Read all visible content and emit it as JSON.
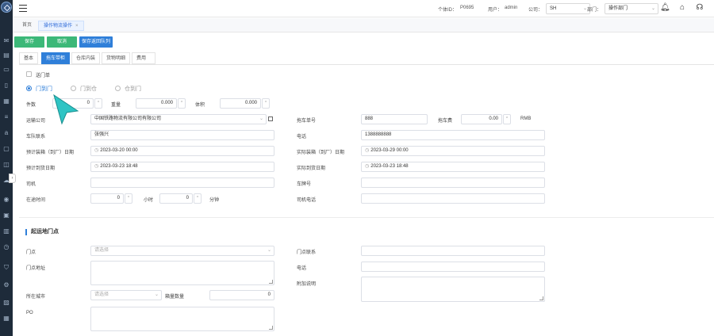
{
  "topbar": {
    "customer_id_label": "个体ID：",
    "customer_id_value": "P0695",
    "user_label": "用户：",
    "user_value": "admin",
    "company_label": "公司：",
    "company_value": "SH",
    "dept_label": "部门：",
    "dept_value": "操作部门"
  },
  "tabs": [
    {
      "label": "首页"
    },
    {
      "label": "操作物流操作",
      "close": "×"
    }
  ],
  "buttons": {
    "save": "保存",
    "cancel": "取消",
    "save_return": "保存返回队列"
  },
  "form_tabs": [
    {
      "label": "基本"
    },
    {
      "label": "拖车带柜"
    },
    {
      "label": "仓库内装"
    },
    {
      "label": "货物明细"
    },
    {
      "label": "费用"
    }
  ],
  "main": {
    "door_pickup_label": "送门单",
    "radios": [
      "门到门",
      "门到仓",
      "仓到门"
    ],
    "pieces_label": "件数",
    "pieces_value": "0",
    "weight_label": "重量",
    "weight_value": "0.000",
    "volume_label": "体积",
    "volume_value": "0.000",
    "transport_company_label": "运输公司",
    "transport_company_value": "中国铁路物流有限公司有限公司",
    "team_label": "车队联系",
    "team_value": "张强兴",
    "plan_load_label": "预计装箱（到厂）日期",
    "plan_load_value": "2023-03-20 00:00",
    "plan_arrive_label": "预计到货日期",
    "plan_arrive_value": "2023-03-23 18:48",
    "driver_label": "司机",
    "transit_label": "在途时间",
    "transit_hours_value": "0",
    "hours_unit": "小时",
    "transit_minutes_value": "0",
    "minutes_unit": "分钟",
    "truck_no_label": "拖车单号",
    "truck_no_value": "888",
    "truck_fee_label": "拖车费",
    "truck_fee_value": "0.00",
    "currency": "RMB",
    "phone_label": "电话",
    "phone_value": "1388888888",
    "actual_load_label": "实际装箱（到厂）日期",
    "actual_load_value": "2023-03-29 00:00",
    "actual_arrive_label": "实际到货日期",
    "actual_arrive_value": "2023-03-23 18:48",
    "plate_label": "车牌号",
    "driver_phone_label": "司机电话"
  },
  "origin": {
    "section_title": "起运地门点",
    "door_label": "门点",
    "door_placeholder": "请选择",
    "door_address_label": "门点地址",
    "city_label": "所在城市",
    "city_placeholder": "请选择",
    "container_count_label": "箱量数量",
    "container_count_value": "0",
    "po_label": "PO",
    "contact_label": "门点联系",
    "phone_label": "电话",
    "note_label": "附加说明"
  }
}
